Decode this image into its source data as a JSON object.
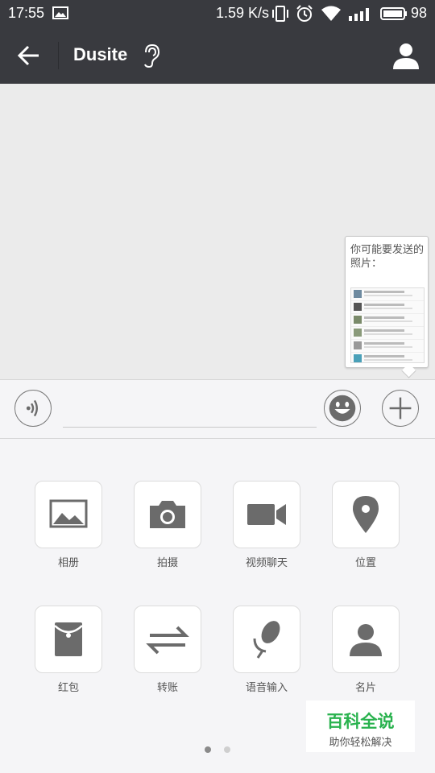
{
  "status_bar": {
    "time": "17:55",
    "network_speed": "1.59 K/s",
    "battery_percent": "98",
    "icons": [
      "image-notification-icon",
      "vibrate-icon",
      "alarm-icon",
      "wifi-icon",
      "signal-icon",
      "battery-icon"
    ]
  },
  "header": {
    "title": "Dusite",
    "back_icon": "arrow-left-icon",
    "earpiece_icon": "ear-icon",
    "profile_icon": "person-icon",
    "background_color": "#393a3f"
  },
  "photo_suggestion": {
    "text": "你可能要发送的照片："
  },
  "input_bar": {
    "voice_icon": "voice-wave-icon",
    "emoji_icon": "smiley-icon",
    "more_icon": "plus-icon",
    "value": ""
  },
  "panel": {
    "items": [
      {
        "label": "相册",
        "icon": "image-icon"
      },
      {
        "label": "拍摄",
        "icon": "camera-icon"
      },
      {
        "label": "视频聊天",
        "icon": "video-camera-icon"
      },
      {
        "label": "位置",
        "icon": "location-pin-icon"
      },
      {
        "label": "红包",
        "icon": "red-envelope-icon"
      },
      {
        "label": "转账",
        "icon": "transfer-arrows-icon"
      },
      {
        "label": "语音输入",
        "icon": "microphone-icon"
      },
      {
        "label": "名片",
        "icon": "contact-card-icon"
      }
    ],
    "page_count": 2,
    "active_page": 1
  },
  "watermark": {
    "title": "百科全说",
    "subtitle": "助你轻松解决",
    "color": "#29b24e"
  },
  "colors": {
    "icon_gray": "#6b6b6b",
    "chat_background": "#ebebeb"
  }
}
